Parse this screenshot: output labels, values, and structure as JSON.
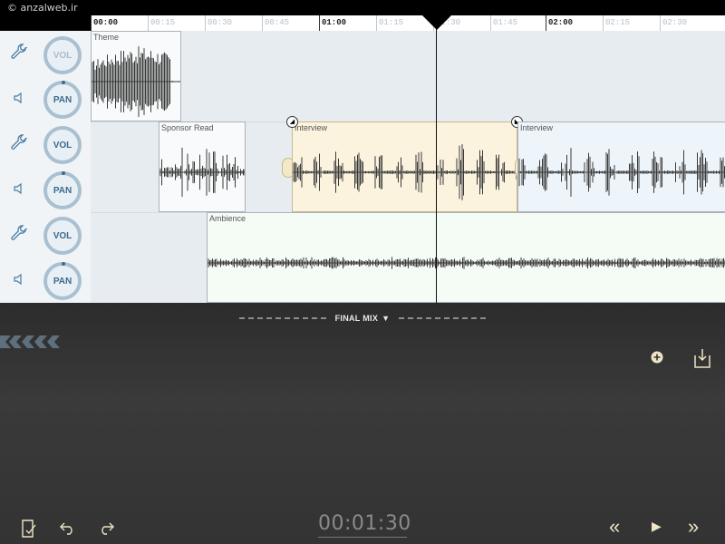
{
  "watermark": "© anzalweb.ir",
  "ruler": {
    "ticks": [
      "00:00",
      "00:15",
      "00:30",
      "00:45",
      "01:00",
      "01:15",
      "01:30",
      "01:45",
      "02:00",
      "02:15",
      "02:30"
    ]
  },
  "controls": {
    "vol_label": "VOL",
    "pan_label": "PAN"
  },
  "clips": {
    "theme": "Theme",
    "sponsor": "Sponsor Read",
    "interview_a": "Interview",
    "interview_b": "Interview",
    "ambience": "Ambience"
  },
  "mix": {
    "label": "FINAL MIX",
    "arrow": "▼"
  },
  "transport": {
    "timecode": "00:01:30",
    "rewind": "«",
    "play": "▶",
    "forward": "»"
  },
  "colors": {
    "accent": "#efe4c8",
    "selected_clip": "#fbf3dd",
    "panel": "#333333"
  },
  "icons": [
    "wrench-icon",
    "speaker-icon",
    "add-icon",
    "export-icon",
    "edit-icon",
    "undo-icon",
    "redo-icon"
  ]
}
